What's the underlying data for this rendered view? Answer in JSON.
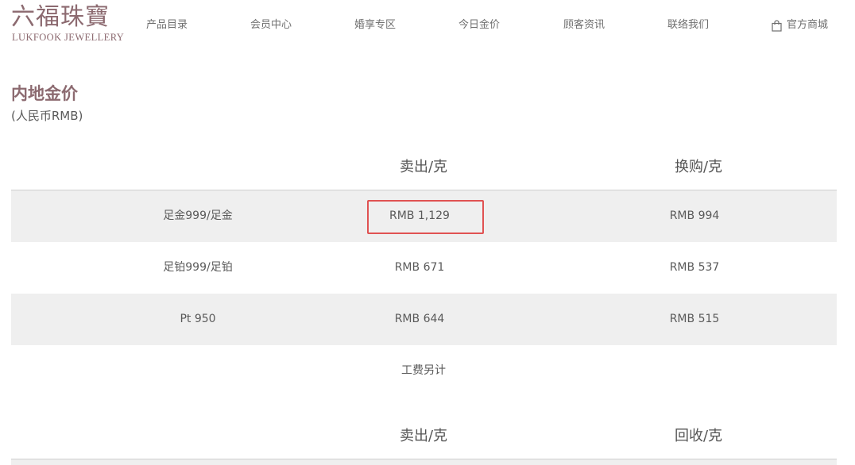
{
  "header": {
    "logo_cn": "六福珠寶",
    "logo_en": "LUKFOOK JEWELLERY",
    "nav": [
      {
        "label": "产品目录"
      },
      {
        "label": "会员中心"
      },
      {
        "label": "婚享专区"
      },
      {
        "label": "今日金价"
      },
      {
        "label": "顾客资讯"
      },
      {
        "label": "联络我们"
      },
      {
        "label": "官方商城",
        "icon": "shopping-bag-icon"
      }
    ]
  },
  "main": {
    "title": "内地金价",
    "subtitle": "(人民币RMB)",
    "table1": {
      "headers": [
        "卖出/克",
        "换购/克"
      ],
      "rows": [
        {
          "name": "足金999/足金",
          "sell": "RMB 1,129",
          "exchange": "RMB 994",
          "shaded": true,
          "highlighted": true
        },
        {
          "name": "足铂999/足铂",
          "sell": "RMB 671",
          "exchange": "RMB 537",
          "shaded": false
        },
        {
          "name": "Pt 950",
          "sell": "RMB 644",
          "exchange": "RMB 515",
          "shaded": true
        }
      ],
      "note": "工费另计"
    },
    "table2": {
      "headers": [
        "卖出/克",
        "回收/克"
      ]
    }
  },
  "colors": {
    "brand": "#8c6a70",
    "row_shade": "#efefef",
    "highlight": "#e05252",
    "divider": "#cfcfcf"
  }
}
